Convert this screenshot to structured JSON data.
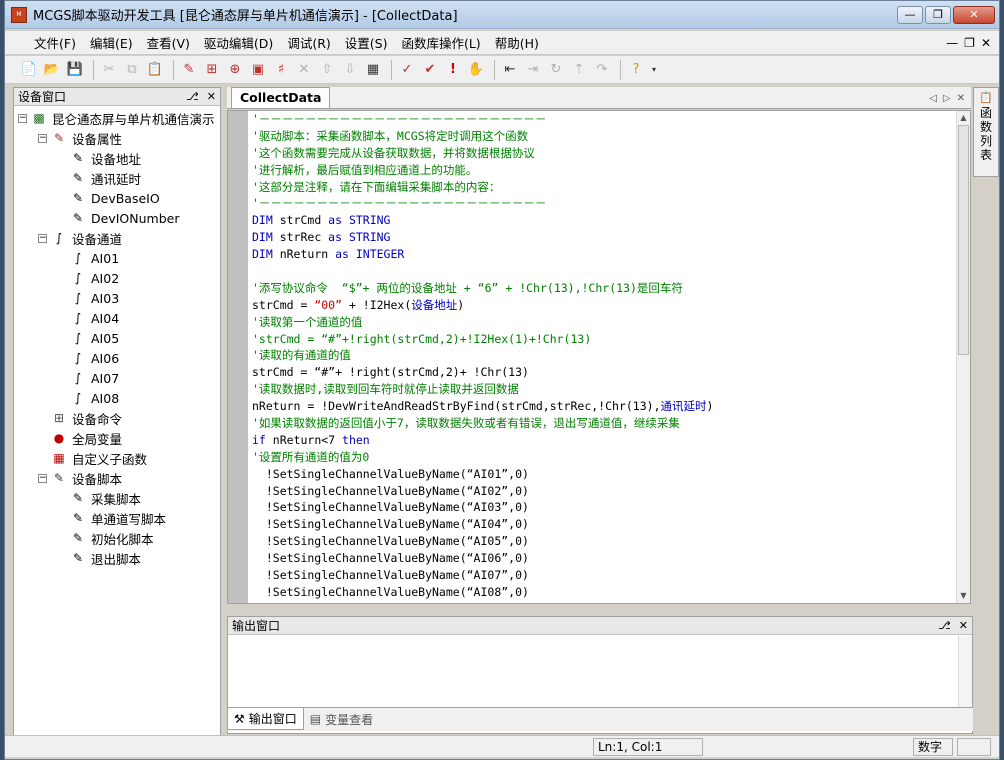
{
  "window": {
    "title": "MCGS脚本驱动开发工具 [昆仑通态屏与单片机通信演示] - [CollectData]"
  },
  "menu": [
    "文件(F)",
    "编辑(E)",
    "查看(V)",
    "驱动编辑(D)",
    "调试(R)",
    "设置(S)",
    "函数库操作(L)",
    "帮助(H)"
  ],
  "device_panel": {
    "title": "设备窗口",
    "root": "昆仑通态屏与单片机通信演示",
    "nodes": [
      {
        "label": "设备属性",
        "children": [
          "设备地址",
          "通讯延时",
          "DevBaseIO",
          "DevIONumber"
        ]
      },
      {
        "label": "设备通道",
        "children": [
          "AI01",
          "AI02",
          "AI03",
          "AI04",
          "AI05",
          "AI06",
          "AI07",
          "AI08"
        ]
      },
      {
        "label": "设备命令",
        "children": []
      },
      {
        "label": "全局变量",
        "children": []
      },
      {
        "label": "自定义子函数",
        "children": []
      },
      {
        "label": "设备脚本",
        "children": [
          "采集脚本",
          "单通道写脚本",
          "初始化脚本",
          "退出脚本"
        ]
      }
    ]
  },
  "editor": {
    "tab": "CollectData",
    "lines": [
      [
        {
          "c": "cm",
          "t": "'－－－－－－－－－－－－－－－－－－－－－－－－－"
        }
      ],
      [
        {
          "c": "cm",
          "t": "'驱动脚本：采集函数脚本，MCGS将定时调用这个函数"
        }
      ],
      [
        {
          "c": "cm",
          "t": "'这个函数需要完成从设备获取数据，并将数据根据协议"
        }
      ],
      [
        {
          "c": "cm",
          "t": "'进行解析，最后赋值到相应通道上的功能。"
        }
      ],
      [
        {
          "c": "cm",
          "t": "'这部分是注释，请在下面编辑采集脚本的内容："
        }
      ],
      [
        {
          "c": "cm",
          "t": "'－－－－－－－－－－－－－－－－－－－－－－－－－"
        }
      ],
      [
        {
          "c": "kw",
          "t": "DIM "
        },
        {
          "c": "tx",
          "t": "strCmd "
        },
        {
          "c": "kw",
          "t": "as STRING"
        }
      ],
      [
        {
          "c": "kw",
          "t": "DIM "
        },
        {
          "c": "tx",
          "t": "strRec "
        },
        {
          "c": "kw",
          "t": "as STRING"
        }
      ],
      [
        {
          "c": "kw",
          "t": "DIM "
        },
        {
          "c": "tx",
          "t": "nReturn "
        },
        {
          "c": "kw",
          "t": "as INTEGER"
        }
      ],
      [
        {
          "c": "tx",
          "t": ""
        }
      ],
      [
        {
          "c": "cm",
          "t": "'添写协议命令  “$”+ 两位的设备地址 + “6” + !Chr(13),!Chr(13)是回车符"
        }
      ],
      [
        {
          "c": "tx",
          "t": "strCmd = "
        },
        {
          "c": "st",
          "t": "“00”"
        },
        {
          "c": "tx",
          "t": " + !I2Hex("
        },
        {
          "c": "kw",
          "t": "设备地址"
        },
        {
          "c": "tx",
          "t": ")"
        }
      ],
      [
        {
          "c": "cm",
          "t": "'读取第一个通道的值"
        }
      ],
      [
        {
          "c": "cm",
          "t": "'strCmd = “#”+!right(strCmd,2)+!I2Hex(1)+!Chr(13)"
        }
      ],
      [
        {
          "c": "cm",
          "t": "'读取的有通道的值"
        }
      ],
      [
        {
          "c": "tx",
          "t": "strCmd = “#”+ !right(strCmd,2)+ !Chr(13)"
        }
      ],
      [
        {
          "c": "cm",
          "t": "'读取数据时,读取到回车符时就停止读取并返回数据"
        }
      ],
      [
        {
          "c": "tx",
          "t": "nReturn = !DevWriteAndReadStrByFind(strCmd,strRec,!Chr(13),"
        },
        {
          "c": "kw",
          "t": "通讯延时"
        },
        {
          "c": "tx",
          "t": ")"
        }
      ],
      [
        {
          "c": "cm",
          "t": "'如果读取数据的返回值小于7，读取数据失败或者有错误，退出写通道值，继续采集"
        }
      ],
      [
        {
          "c": "kw",
          "t": "if "
        },
        {
          "c": "tx",
          "t": "nReturn<7 "
        },
        {
          "c": "kw",
          "t": "then"
        }
      ],
      [
        {
          "c": "cm",
          "t": "'设置所有通道的值为0"
        }
      ],
      [
        {
          "c": "tx",
          "t": "  !SetSingleChannelValueByName(“AI01”,0)"
        }
      ],
      [
        {
          "c": "tx",
          "t": "  !SetSingleChannelValueByName(“AI02”,0)"
        }
      ],
      [
        {
          "c": "tx",
          "t": "  !SetSingleChannelValueByName(“AI03”,0)"
        }
      ],
      [
        {
          "c": "tx",
          "t": "  !SetSingleChannelValueByName(“AI04”,0)"
        }
      ],
      [
        {
          "c": "tx",
          "t": "  !SetSingleChannelValueByName(“AI05”,0)"
        }
      ],
      [
        {
          "c": "tx",
          "t": "  !SetSingleChannelValueByName(“AI06”,0)"
        }
      ],
      [
        {
          "c": "tx",
          "t": "  !SetSingleChannelValueByName(“AI07”,0)"
        }
      ],
      [
        {
          "c": "tx",
          "t": "  !SetSingleChannelValueByName(“AI08”,0)"
        }
      ]
    ]
  },
  "right_strip": {
    "tab": "函数列表"
  },
  "output_panel": {
    "title": "输出窗口"
  },
  "bottom_tabs": [
    "输出窗口",
    "变量查看"
  ],
  "status": {
    "position": "Ln:1, Col:1",
    "mode": "数字"
  }
}
